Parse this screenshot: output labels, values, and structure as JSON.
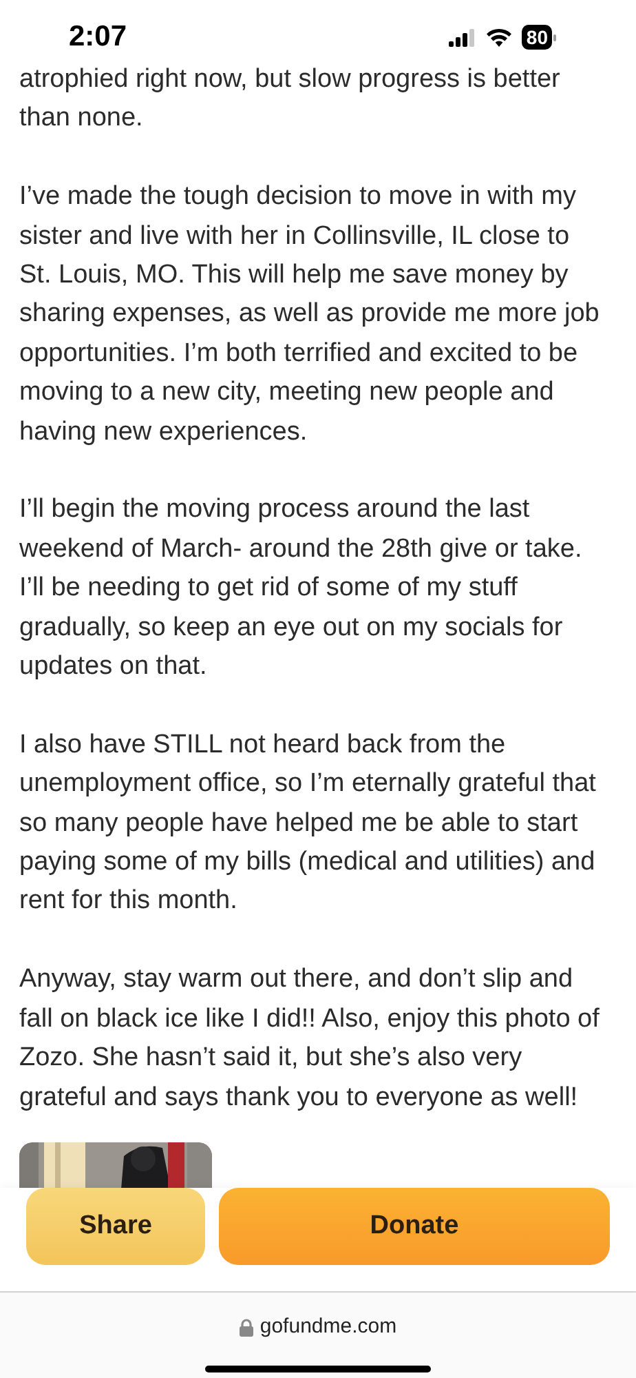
{
  "status_bar": {
    "time": "2:07",
    "battery": "80"
  },
  "story": {
    "paragraphs": [
      "atrophied right now, but slow progress is better than none.",
      "I’ve made the tough decision to move in with my sister and live with her in Collinsville, IL close to St. Louis, MO. This will help me save money by sharing expenses, as well as provide me more job opportunities. I’m both terrified and excited to be moving to a new city, meeting new people and having new experiences.",
      "I’ll begin the moving process around the last weekend of March- around the 28th give or take. I’ll be needing to get rid of some of my stuff gradually, so keep an eye out on my socials for updates on that.",
      "I also have STILL not heard back from the unemployment office, so I’m eternally grateful that so many people have helped me be able to start paying some of my bills (medical and utilities) and rent for this month.",
      "Anyway, stay warm out there, and don’t slip and fall on black ice like I did!! Also, enjoy this photo of Zozo. She hasn’t said it, but she’s also very grateful and says thank you to everyone as well!"
    ]
  },
  "actions": [
    {
      "label": "Share",
      "kind": "secondary"
    },
    {
      "label": "Donate",
      "kind": "primary"
    }
  ],
  "address_bar": {
    "url": "gofundme.com"
  }
}
